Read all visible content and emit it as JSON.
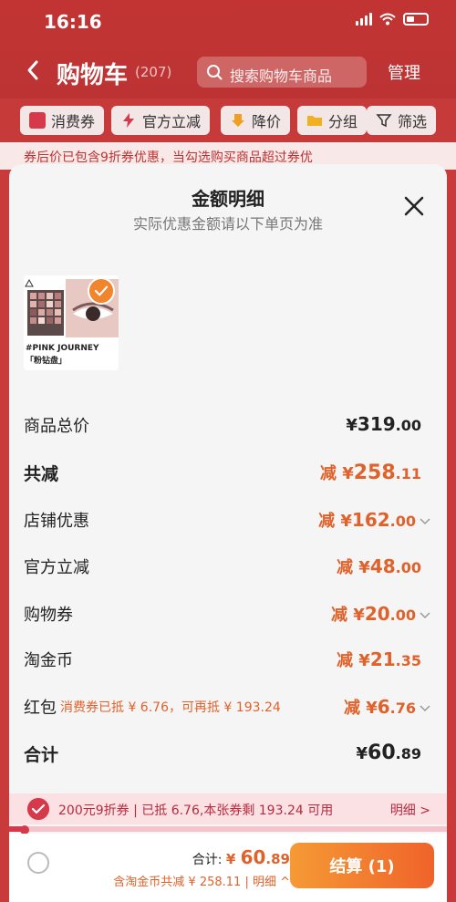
{
  "status_bar": {
    "time": "16:16"
  },
  "nav": {
    "title": "购物车",
    "count": "(207)",
    "search_placeholder": "搜索购物车商品",
    "manage": "管理"
  },
  "filters": [
    {
      "label": "消费券",
      "icon": "coupon-icon"
    },
    {
      "label": "官方立减",
      "icon": "lightning-icon"
    },
    {
      "label": "降价",
      "icon": "price-down-icon"
    },
    {
      "label": "分组",
      "icon": "folder-icon"
    },
    {
      "label": "筛选",
      "icon": "filter-icon"
    }
  ],
  "promo_strip": "券后价已包含9折券优惠，当勾选购买商品超过券优",
  "sheet": {
    "title": "金额明细",
    "subtitle": "实际优惠金额请以下单页为准",
    "product": {
      "brand_text": "#PINK JOURNEY",
      "sub_text": "「粉钻盘」"
    }
  },
  "rows": {
    "total_price": {
      "label": "商品总价",
      "pre": "¥",
      "int": "319",
      "cents": ".00"
    },
    "discount": {
      "label": "共减",
      "pre": "减 ¥",
      "int": "258",
      "cents": ".11"
    },
    "store": {
      "label": "店铺优惠",
      "pre": "减 ¥",
      "int": "162",
      "cents": ".00"
    },
    "official": {
      "label": "官方立减",
      "pre": "减 ¥",
      "int": "48",
      "cents": ".00"
    },
    "shopping_coupon": {
      "label": "购物券",
      "pre": "减 ¥",
      "int": "20",
      "cents": ".00"
    },
    "taojinbi": {
      "label": "淘金币",
      "pre": "减 ¥",
      "int": "21",
      "cents": ".35"
    },
    "redpacket": {
      "label": "红包",
      "note": "消费券已抵 ¥ 6.76，可再抵 ¥ 193.24",
      "pre": "减 ¥",
      "int": "6",
      "cents": ".76"
    },
    "sum": {
      "label": "合计",
      "pre": "¥",
      "int": "60",
      "cents": ".89"
    }
  },
  "coupon_bar": {
    "text": "200元9折券 | 已抵 6.76,本张券剩 193.24 可用",
    "link": "明细 >",
    "progress": 0.035
  },
  "footer": {
    "total_label": "合计: ",
    "total_pre": "¥ ",
    "total_int": "60",
    "total_cents": ".89",
    "sub_text": "含淘金币共减 ¥ 258.11 | 明细 ^",
    "checkout": "结算 (1)"
  },
  "colors": {
    "accent": "#e0622a",
    "brand_red": "#c23434",
    "coupon_red": "#d5394a"
  }
}
